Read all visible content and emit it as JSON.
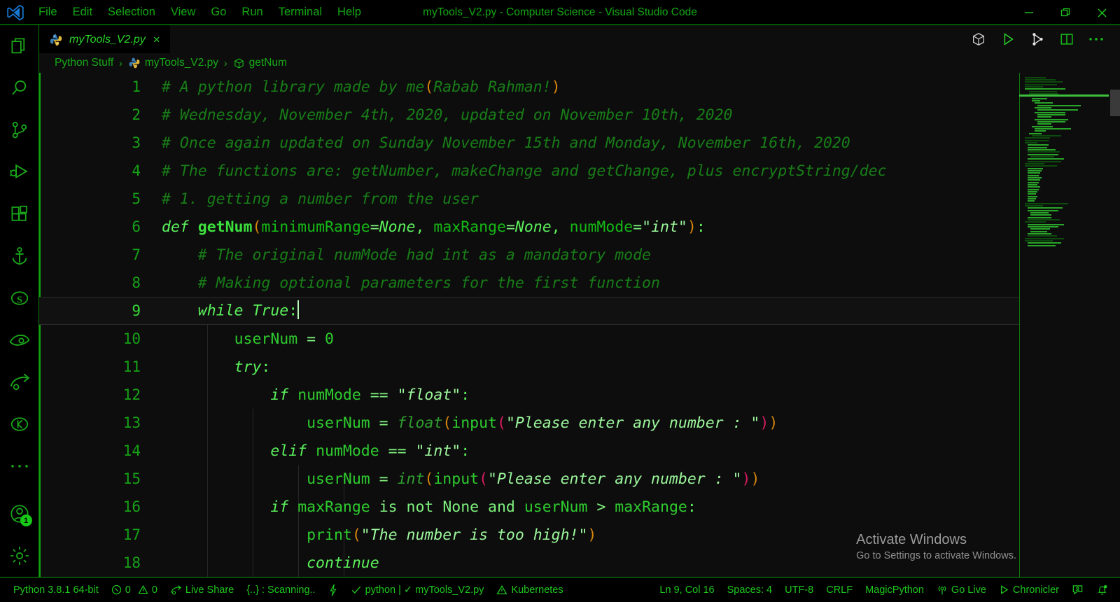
{
  "window": {
    "title": "myTools_V2.py - Computer Science - Visual Studio Code",
    "minimize_label": "minimize-icon",
    "restore_label": "restore-icon",
    "close_label": "close-icon"
  },
  "menu": {
    "items": [
      {
        "label": "File"
      },
      {
        "label": "Edit"
      },
      {
        "label": "Selection"
      },
      {
        "label": "View"
      },
      {
        "label": "Go"
      },
      {
        "label": "Run"
      },
      {
        "label": "Terminal"
      },
      {
        "label": "Help"
      }
    ]
  },
  "activity_bar": {
    "items": [
      {
        "icon": "files-explorer-icon",
        "name": "explorer"
      },
      {
        "icon": "search-icon",
        "name": "search"
      },
      {
        "icon": "source-control-icon",
        "name": "source-control"
      },
      {
        "icon": "run-and-debug-icon",
        "name": "run-debug"
      },
      {
        "icon": "extensions-icon",
        "name": "extensions"
      },
      {
        "icon": "anchor-docker-icon",
        "name": "docker"
      },
      {
        "icon": "s-circle-icon",
        "name": "sourcery"
      },
      {
        "icon": "eye-icon",
        "name": "live-preview"
      },
      {
        "icon": "live-share-icon",
        "name": "live-share"
      },
      {
        "icon": "kubernetes-icon",
        "name": "kubernetes"
      },
      {
        "icon": "ellipsis-icon",
        "name": "additional-views"
      }
    ],
    "account": {
      "icon": "account-icon",
      "badge": "1"
    },
    "settings": {
      "icon": "gear-icon"
    }
  },
  "tabs": [
    {
      "label": "myTools_V2.py",
      "icon": "python-file-icon",
      "close": "×",
      "active": true
    }
  ],
  "editor_actions": [
    {
      "icon": "cube-icon",
      "name": "open-preview",
      "color": "#d0d0d0"
    },
    {
      "icon": "run-play-icon",
      "name": "run-python-file",
      "color": "#2bd42b"
    },
    {
      "icon": "split-branch-icon",
      "name": "git-branch",
      "color": "#e8e8e8"
    },
    {
      "icon": "split-editor-icon",
      "name": "split-editor-right",
      "color": "#19c219"
    },
    {
      "icon": "ellipsis-icon",
      "name": "more-actions",
      "color": "#19c219"
    }
  ],
  "breadcrumb": {
    "items": [
      {
        "label": "Python Stuff",
        "icon": ""
      },
      {
        "label": "myTools_V2.py",
        "icon": "python-file-icon"
      },
      {
        "label": "getNum",
        "icon": "symbol-method-icon"
      }
    ],
    "separator": "›"
  },
  "code": {
    "lines": [
      {
        "n": "1",
        "active": false,
        "tokens": [
          {
            "t": "# A python library made by me",
            "c": "cm"
          },
          {
            "t": "(",
            "c": "p1"
          },
          {
            "t": "Rabab Rahman!",
            "c": "cm"
          },
          {
            "t": ")",
            "c": "p1"
          }
        ]
      },
      {
        "n": "2",
        "active": false,
        "tokens": [
          {
            "t": "# Wednesday, November 4th, 2020, updated on November 10th, 2020",
            "c": "cm"
          }
        ]
      },
      {
        "n": "3",
        "active": false,
        "tokens": [
          {
            "t": "# Once again updated on Sunday November 15th and Monday, November 16th, 2020",
            "c": "cm"
          }
        ]
      },
      {
        "n": "4",
        "active": false,
        "tokens": [
          {
            "t": "# The functions are: getNumber, makeChange and getChange, plus encryptString/dec",
            "c": "cm"
          }
        ]
      },
      {
        "n": "5",
        "active": false,
        "tokens": [
          {
            "t": "# 1. getting a number from the user",
            "c": "cm"
          }
        ]
      },
      {
        "n": "6",
        "active": false,
        "tokens": [
          {
            "t": "def ",
            "c": "kw"
          },
          {
            "t": "getNum",
            "c": "fn"
          },
          {
            "t": "(",
            "c": "p1"
          },
          {
            "t": "minimumRange",
            "c": "id"
          },
          {
            "t": "=",
            "c": "op"
          },
          {
            "t": "None",
            "c": "kw"
          },
          {
            "t": ", ",
            "c": "punc"
          },
          {
            "t": "maxRange",
            "c": "id"
          },
          {
            "t": "=",
            "c": "op"
          },
          {
            "t": "None",
            "c": "kw"
          },
          {
            "t": ", ",
            "c": "punc"
          },
          {
            "t": "numMode",
            "c": "id"
          },
          {
            "t": "=",
            "c": "op"
          },
          {
            "t": "\"int\"",
            "c": "str"
          },
          {
            "t": ")",
            "c": "p1"
          },
          {
            "t": ":",
            "c": "punc"
          }
        ]
      },
      {
        "n": "7",
        "active": false,
        "tokens": [
          {
            "t": "    # The original numMode had int as a mandatory mode",
            "c": "cm"
          }
        ]
      },
      {
        "n": "8",
        "active": false,
        "tokens": [
          {
            "t": "    # Making optional parameters for the first function",
            "c": "cm"
          }
        ]
      },
      {
        "n": "9",
        "active": true,
        "tokens": [
          {
            "t": "    ",
            "c": "punc"
          },
          {
            "t": "while",
            "c": "kw"
          },
          {
            "t": " ",
            "c": "punc"
          },
          {
            "t": "True",
            "c": "kw"
          },
          {
            "t": ":",
            "c": "punc"
          }
        ],
        "cursor": true
      },
      {
        "n": "10",
        "active": false,
        "tokens": [
          {
            "t": "        ",
            "c": "punc"
          },
          {
            "t": "userNum",
            "c": "var"
          },
          {
            "t": " = ",
            "c": "op"
          },
          {
            "t": "0",
            "c": "var"
          }
        ]
      },
      {
        "n": "11",
        "active": false,
        "tokens": [
          {
            "t": "        ",
            "c": "punc"
          },
          {
            "t": "try",
            "c": "kw"
          },
          {
            "t": ":",
            "c": "punc"
          }
        ]
      },
      {
        "n": "12",
        "active": false,
        "tokens": [
          {
            "t": "            ",
            "c": "punc"
          },
          {
            "t": "if",
            "c": "kw"
          },
          {
            "t": " ",
            "c": "punc"
          },
          {
            "t": "numMode",
            "c": "var"
          },
          {
            "t": " == ",
            "c": "op"
          },
          {
            "t": "\"float\"",
            "c": "str"
          },
          {
            "t": ":",
            "c": "punc"
          }
        ]
      },
      {
        "n": "13",
        "active": false,
        "tokens": [
          {
            "t": "                ",
            "c": "punc"
          },
          {
            "t": "userNum",
            "c": "var"
          },
          {
            "t": " = ",
            "c": "op"
          },
          {
            "t": "float",
            "c": "bi"
          },
          {
            "t": "(",
            "c": "p1"
          },
          {
            "t": "input",
            "c": "var"
          },
          {
            "t": "(",
            "c": "p2"
          },
          {
            "t": "\"Please enter any number : \"",
            "c": "str"
          },
          {
            "t": ")",
            "c": "p2"
          },
          {
            "t": ")",
            "c": "p1"
          }
        ]
      },
      {
        "n": "14",
        "active": false,
        "tokens": [
          {
            "t": "            ",
            "c": "punc"
          },
          {
            "t": "elif",
            "c": "kw"
          },
          {
            "t": " ",
            "c": "punc"
          },
          {
            "t": "numMode",
            "c": "var"
          },
          {
            "t": " == ",
            "c": "op"
          },
          {
            "t": "\"int\"",
            "c": "str"
          },
          {
            "t": ":",
            "c": "punc"
          }
        ]
      },
      {
        "n": "15",
        "active": false,
        "tokens": [
          {
            "t": "                ",
            "c": "punc"
          },
          {
            "t": "userNum",
            "c": "var"
          },
          {
            "t": " = ",
            "c": "op"
          },
          {
            "t": "int",
            "c": "bi"
          },
          {
            "t": "(",
            "c": "p1"
          },
          {
            "t": "input",
            "c": "var"
          },
          {
            "t": "(",
            "c": "p2"
          },
          {
            "t": "\"Please enter any number : \"",
            "c": "str"
          },
          {
            "t": ")",
            "c": "p2"
          },
          {
            "t": ")",
            "c": "p1"
          }
        ]
      },
      {
        "n": "16",
        "active": false,
        "tokens": [
          {
            "t": "            ",
            "c": "punc"
          },
          {
            "t": "if",
            "c": "kw"
          },
          {
            "t": " ",
            "c": "punc"
          },
          {
            "t": "maxRange",
            "c": "var"
          },
          {
            "t": " is not ",
            "c": "op"
          },
          {
            "t": "None",
            "c": "op"
          },
          {
            "t": " and ",
            "c": "op"
          },
          {
            "t": "userNum",
            "c": "var"
          },
          {
            "t": " > ",
            "c": "op"
          },
          {
            "t": "maxRange",
            "c": "var"
          },
          {
            "t": ":",
            "c": "punc"
          }
        ]
      },
      {
        "n": "17",
        "active": false,
        "tokens": [
          {
            "t": "                ",
            "c": "punc"
          },
          {
            "t": "print",
            "c": "var"
          },
          {
            "t": "(",
            "c": "p1"
          },
          {
            "t": "\"The number is too high!\"",
            "c": "str"
          },
          {
            "t": ")",
            "c": "p1"
          }
        ]
      },
      {
        "n": "18",
        "active": false,
        "tokens": [
          {
            "t": "                ",
            "c": "punc"
          },
          {
            "t": "continue",
            "c": "kw"
          }
        ]
      }
    ]
  },
  "watermark": {
    "title": "Activate Windows",
    "subtitle": "Go to Settings to activate Windows."
  },
  "status_bar": {
    "left": [
      {
        "label": "Python 3.8.1 64-bit",
        "icon": ""
      },
      {
        "label": "0",
        "icon": "error-icon",
        "label2": "0",
        "icon2": "warning-icon"
      },
      {
        "label": "Live Share",
        "icon": "live-share-icon"
      },
      {
        "label": "{..} : Scanning..",
        "icon": ""
      },
      {
        "label": "",
        "icon": "lightning-icon"
      },
      {
        "label": "python | ✓ myTools_V2.py",
        "icon": "check-icon"
      },
      {
        "label": "Kubernetes",
        "icon": "warning-icon"
      }
    ],
    "right": [
      {
        "label": "Ln 9, Col 16",
        "icon": ""
      },
      {
        "label": "Spaces: 4",
        "icon": ""
      },
      {
        "label": "UTF-8",
        "icon": ""
      },
      {
        "label": "CRLF",
        "icon": ""
      },
      {
        "label": "MagicPython",
        "icon": ""
      },
      {
        "label": "Go Live",
        "icon": "broadcast-icon"
      },
      {
        "label": "Chronicler",
        "icon": "play-icon"
      },
      {
        "label": "",
        "icon": "feedback-icon"
      },
      {
        "label": "",
        "icon": "bell-dot-icon"
      }
    ]
  },
  "colors": {
    "accent_green": "#1ec81e",
    "comment_green": "#187d18",
    "keyword_green": "#5cf25c",
    "string_green": "#9cf79c",
    "bracket_orange": "#d8860b",
    "bracket_pink": "#d81b60",
    "background": "#0d0d0d",
    "titlebar_bg": "#000000"
  }
}
